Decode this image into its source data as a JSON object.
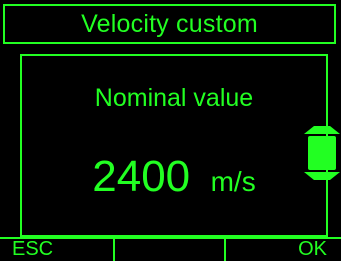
{
  "title": "Velocity custom",
  "field": {
    "label": "Nominal value",
    "value": "2400",
    "unit": "m/s"
  },
  "stepper": {
    "icon": "up-down-stepper-icon"
  },
  "softkeys": {
    "left": "ESC",
    "center": "",
    "right": "OK"
  },
  "colors": {
    "foreground": "#22ff22",
    "background": "#000000"
  }
}
